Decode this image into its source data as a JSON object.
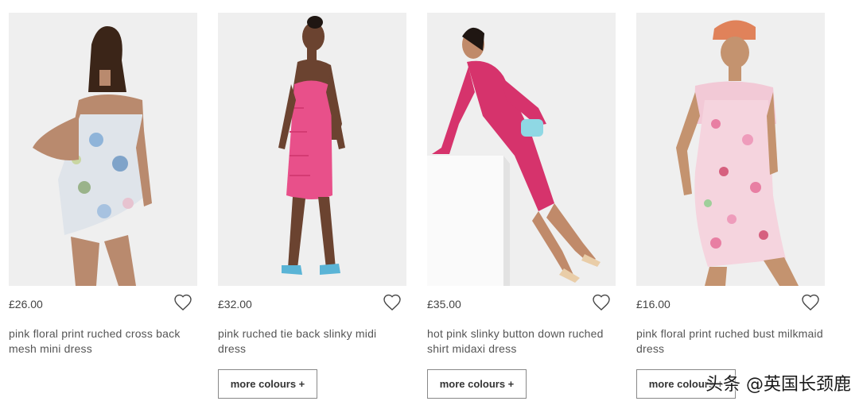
{
  "products": [
    {
      "price": "£26.00",
      "title": "pink floral print ruched cross back mesh mini dress",
      "more_label": ""
    },
    {
      "price": "£32.00",
      "title": "pink ruched tie back slinky midi dress",
      "more_label": "more colours +"
    },
    {
      "price": "£35.00",
      "title": "hot pink slinky button down ruched shirt midaxi dress",
      "more_label": "more colours +"
    },
    {
      "price": "£16.00",
      "title": "pink floral print ruched bust milkmaid dress",
      "more_label": "more colours +"
    }
  ],
  "icons": {
    "wishlist": "heart-outline-icon"
  },
  "colors": {
    "dress_pink": "#e8508a",
    "hot_pink": "#d6336c",
    "floral": "#f2c9d6",
    "photo_bg": "#eeeeee"
  },
  "watermark": "头条 @英国长颈鹿"
}
